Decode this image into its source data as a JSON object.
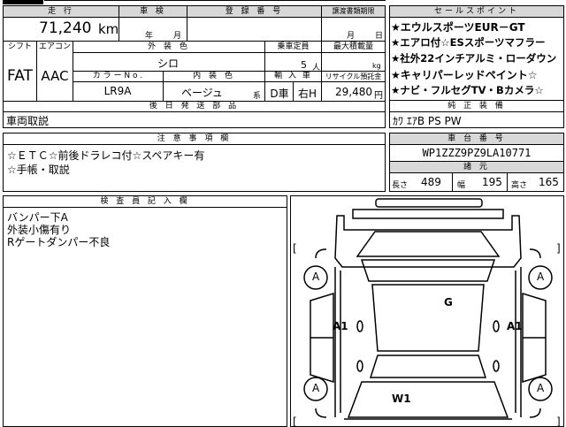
{
  "header": {
    "mileage_label": "走 行",
    "mileage_value": "71,240",
    "mileage_unit": "km",
    "inspection_label": "車 検",
    "inspection_year_unit": "年",
    "inspection_month_unit": "月",
    "reg_number_label": "登 録 番 号",
    "transfer_deadline_label": "譲渡書類期限",
    "transfer_month_unit": "月",
    "transfer_day_unit": "日"
  },
  "spec": {
    "shift_label": "シフト",
    "shift_value": "FAT",
    "aircon_label": "エアコン",
    "aircon_value": "AAC",
    "exterior_color_label": "外 装 色",
    "exterior_color_value": "シロ",
    "capacity_label": "乗車定員",
    "capacity_value": "5",
    "capacity_unit": "人",
    "max_load_label": "最大積載量",
    "max_load_unit": "kg",
    "color_no_label": "カ ラ ー  N o .",
    "color_no_value": "LR9A",
    "interior_color_label": "内 装 色",
    "interior_color_value": "ベージュ",
    "interior_color_suffix": "系",
    "import_label": "輸 入 車",
    "import_drive": "D車",
    "import_handle": "右H",
    "recycle_label": "リサイクル預託金",
    "recycle_value": "29,480",
    "recycle_unit": "円",
    "rear_parts_label": "後 日 発 送 部 品"
  },
  "notes": {
    "rear_parts_value": "車両取説",
    "caution_label": "注 意 事 項 欄",
    "caution_lines": [
      "☆ＥＴＣ☆前後ドラレコ付☆スペアキー有",
      "☆手帳・取説"
    ],
    "inspector_label": "検 査 員 記 入 欄",
    "inspector_lines": [
      "バンパー下A",
      "外装小傷有り",
      "Rゲートダンパー不良"
    ]
  },
  "sales": {
    "title": "セールスポイント",
    "points": [
      "★エウルスポーツEUR－GT",
      "★エアロ付☆ESスポーツマフラー",
      "★社外22インチアルミ・ローダウン",
      "★キャリパーレッドペイント☆",
      "★ナビ・フルセグTV・Bカメラ☆"
    ],
    "equipment_label": "純 正 装 備",
    "equipment_value": "ｶﾜ ｴｱB PS PW",
    "chassis_label": "車 台 番 号",
    "chassis_value": "WP1ZZZ9PZ9LA10771",
    "dims_label": "諸 元",
    "length_label": "長さ",
    "length_value": "489",
    "width_label": "幅",
    "width_value": "195",
    "height_label": "高さ",
    "height_value": "165"
  },
  "diagram": {
    "marks": [
      "A",
      "A",
      "A",
      "A",
      "A1",
      "A1",
      "G",
      "W1"
    ],
    "bracket_left": "[",
    "bracket_right": "]"
  }
}
